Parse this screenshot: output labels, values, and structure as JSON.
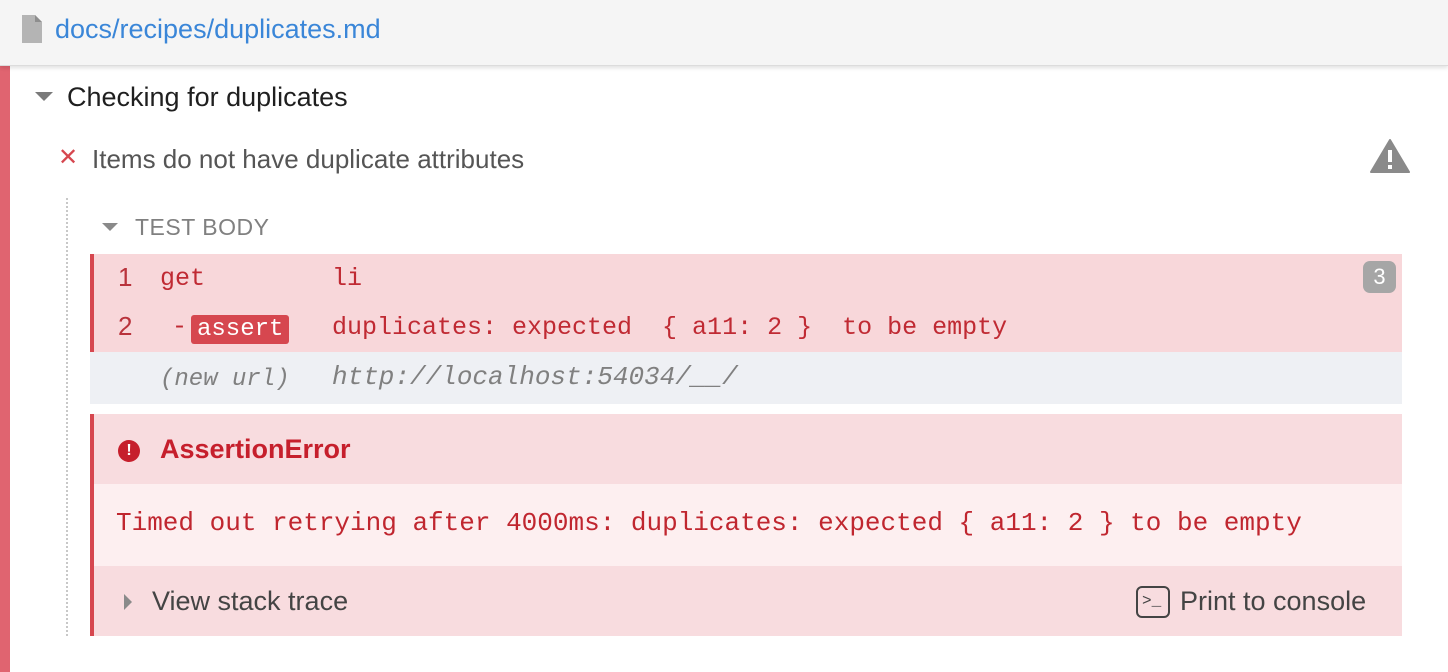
{
  "header": {
    "file_path": "docs/recipes/duplicates.md"
  },
  "suite": {
    "title": "Checking for duplicates"
  },
  "test": {
    "title": "Items do not have duplicate attributes",
    "status": "failed"
  },
  "test_body": {
    "label": "TEST BODY",
    "commands": [
      {
        "number": "1",
        "name": "get",
        "message": "li"
      },
      {
        "number": "2",
        "name": "assert",
        "prefix": "-",
        "message": "duplicates: expected  { a11: 2 }  to be empty"
      }
    ],
    "command_count": "3",
    "new_url": {
      "label": "(new url)",
      "value": "http://localhost:54034/__/"
    }
  },
  "error": {
    "name": "AssertionError",
    "message": "Timed out retrying after 4000ms: duplicates: expected { a11: 2 } to be empty",
    "stack_trace_label": "View stack trace",
    "print_label": "Print to console"
  },
  "colors": {
    "fail": "#d6474f",
    "link": "#3a86d8",
    "error_text": "#c61f2c"
  }
}
